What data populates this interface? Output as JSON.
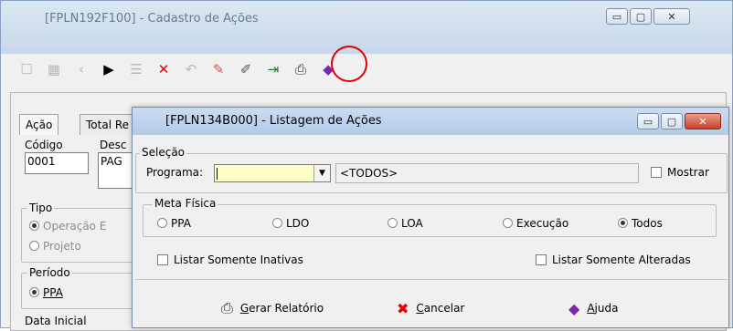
{
  "bg_window": {
    "title": "[FPLN192F100] - Cadastro de Ações",
    "tabs": [
      "Ação",
      "Total Re"
    ],
    "codigo_label": "Código",
    "codigo_value": "0001",
    "desc_label": "Desc",
    "desc_value": "PAG",
    "tipo_label": "Tipo",
    "tipo_options": [
      "Operação E",
      "Projeto"
    ],
    "periodo_label": "Período",
    "periodo_option": "PPA",
    "data_inicial_label": "Data Inicial"
  },
  "dialog": {
    "title": "[FPLN134B000] - Listagem de Ações",
    "selecao_label": "Seleção",
    "programa_label": "Programa:",
    "programa_display": "<TODOS>",
    "mostrar_label": "Mostrar",
    "meta_label": "Meta Física",
    "meta_options": [
      "PPA",
      "LDO",
      "LOA",
      "Execução",
      "Todos"
    ],
    "meta_selected": "Todos",
    "listar_inativas_label": "Listar Somente Inativas",
    "listar_alteradas_label": "Listar Somente Alteradas",
    "buttons": {
      "gerar": {
        "first": "G",
        "rest": "erar Relatório"
      },
      "cancelar": {
        "first": "C",
        "rest": "ancelar"
      },
      "ajuda": {
        "first": "A",
        "rest": "juda"
      }
    }
  },
  "icons": {
    "toolbar": [
      "new-icon",
      "grid-icon",
      "prev-icon",
      "next-icon",
      "list-icon",
      "delete-icon",
      "undo-icon",
      "eraser-icon",
      "edit-icon",
      "exit-icon",
      "print-icon",
      "help-book-icon"
    ]
  },
  "colors": {
    "highlight_circle": "#e00000",
    "combo_bg": "#ffffc8",
    "close_red": "#c8402a"
  }
}
